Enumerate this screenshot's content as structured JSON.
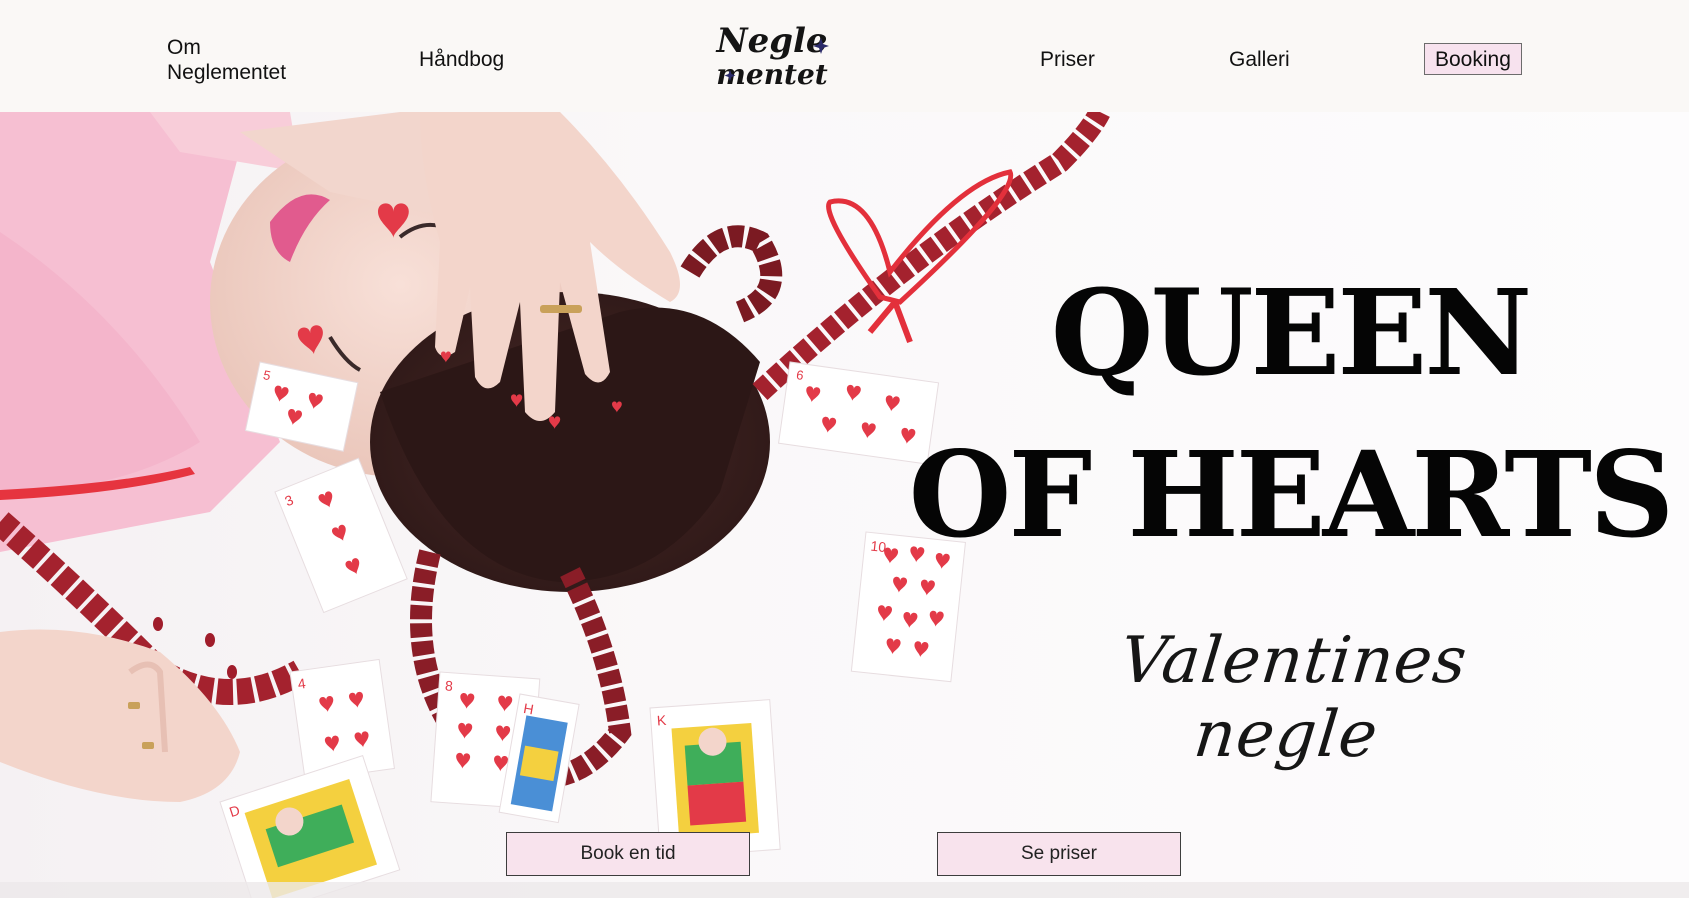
{
  "nav": {
    "om_label": "Om Neglementet",
    "haandbog_label": "Håndbog",
    "priser_label": "Priser",
    "galleri_label": "Galleri",
    "booking_label": "Booking"
  },
  "logo": {
    "line1": "Negle",
    "line2": "mentet",
    "color": "#141414"
  },
  "hero": {
    "title_line1": "QUEEN",
    "title_line2": "OF HEARTS",
    "subtitle": "Valentines negle",
    "primary_button": "Book en tid",
    "secondary_button": "Se priser"
  },
  "colors": {
    "button_bg": "#f8e3ed",
    "accent_red": "#e33a48",
    "hair_red": "#a4222e",
    "shirt_pink": "#f6bfd2"
  },
  "cards": [
    {
      "rank": "5",
      "label": "5 of hearts"
    },
    {
      "rank": "6",
      "label": "6 of hearts"
    },
    {
      "rank": "3",
      "label": "3 of hearts"
    },
    {
      "rank": "10",
      "label": "10 of hearts"
    },
    {
      "rank": "4",
      "label": "4 of hearts"
    },
    {
      "rank": "8",
      "label": "8 of hearts"
    },
    {
      "rank": "K",
      "label": "king of hearts"
    },
    {
      "rank": "H",
      "label": "knight of hearts"
    },
    {
      "rank": "D",
      "label": "queen of hearts"
    }
  ]
}
